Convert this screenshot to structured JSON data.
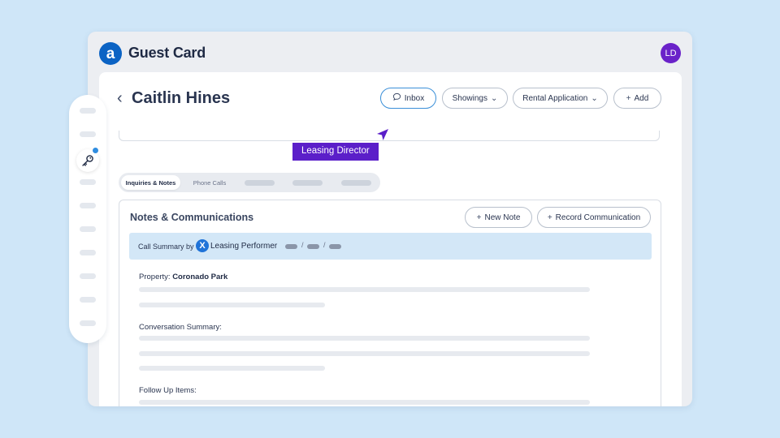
{
  "app": {
    "logo_glyph": "a",
    "title": "Guest Card",
    "avatar_initials": "LD",
    "avatar_color": "#6a22c9"
  },
  "contact": {
    "name": "Caitlin Hines"
  },
  "actions": {
    "inbox_label": "Inbox",
    "showings_label": "Showings",
    "rental_label": "Rental Application",
    "add_label": "Add"
  },
  "tooltip": {
    "text": "Leasing Director",
    "color": "#5b1fc9"
  },
  "tabs": [
    {
      "label": "Inquiries & Notes",
      "selected": true
    },
    {
      "label": "Phone Calls",
      "selected": false
    }
  ],
  "notes": {
    "title": "Notes & Communications",
    "new_note_label": "New Note",
    "record_label": "Record Communication",
    "summary": {
      "prefix": "Call Summary by",
      "product": "Leasing Performer",
      "logo_glyph": "X",
      "separator": "/"
    },
    "property_label": "Property:",
    "property_value": "Coronado Park",
    "conversation_label": "Conversation Summary:",
    "followup_label": "Follow Up Items:"
  },
  "icons": {
    "back": "chevron-left-icon",
    "inbox": "chat-bubble-icon",
    "dropdown": "chevron-down-icon",
    "add": "plus-icon",
    "sidebar_active": "key-icon"
  },
  "colors": {
    "background": "#cfe6f8",
    "accent": "#0b63c4",
    "summary_bar": "#d3e7f7",
    "notification": "#2f8de0"
  }
}
